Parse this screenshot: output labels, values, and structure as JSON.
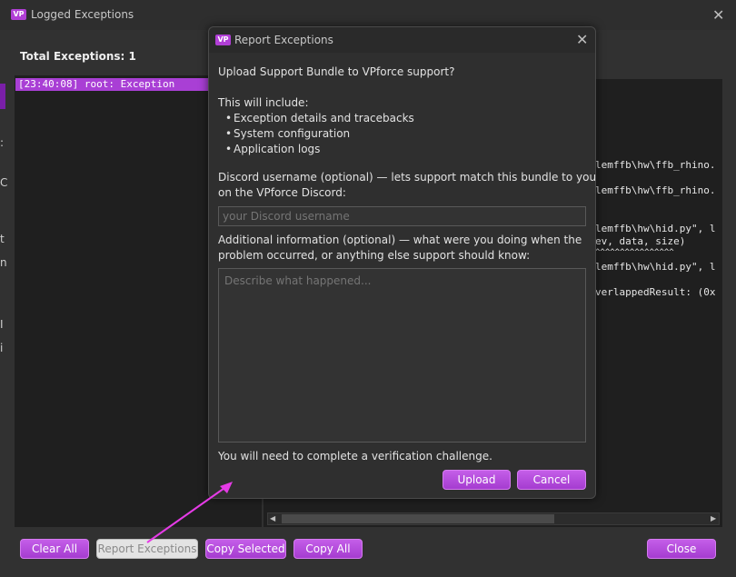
{
  "window": {
    "title": "Logged Exceptions",
    "logo_text": "VP",
    "total_label": "Total Exceptions: 1",
    "exceptions": [
      "[23:40:08] root: Exception"
    ],
    "trace_lines": [
      "lemffb\\hw\\ffb_rhino.",
      "lemffb\\hw\\ffb_rhino.",
      "lemffb\\hw\\hid.py\", l",
      "ev, data, size)",
      "^^^^^^^^^^^^^^^^",
      "lemffb\\hw\\hid.py\", l",
      "verlappedResult: (0x"
    ],
    "edge_glyphs": [
      ":",
      "C",
      "t",
      "n",
      "I",
      "i"
    ],
    "buttons": {
      "clear_all": "Clear All",
      "report_exceptions": "Report Exceptions",
      "copy_selected": "Copy Selected",
      "copy_all": "Copy All",
      "close": "Close"
    }
  },
  "dialog": {
    "title": "Report Exceptions",
    "logo_text": "VP",
    "heading": "Upload Support Bundle to VPforce support?",
    "include_label": "This will include:",
    "includes": [
      "Exception details and tracebacks",
      "System configuration",
      "Application logs"
    ],
    "discord_label_line1": "Discord username (optional) — lets support match this bundle to you",
    "discord_label_line2": "on the VPforce Discord:",
    "discord_placeholder": "your Discord username",
    "info_label_line1": "Additional information (optional) — what were you doing when the",
    "info_label_line2": "problem occurred, or anything else support should know:",
    "info_placeholder": "Describe what happened...",
    "verification_note": "You will need to complete a verification challenge.",
    "upload_button": "Upload",
    "cancel_button": "Cancel"
  },
  "colors": {
    "accent": "#b13fd6",
    "selection": "#a93fd5",
    "annotation_arrow": "#e53be6"
  }
}
